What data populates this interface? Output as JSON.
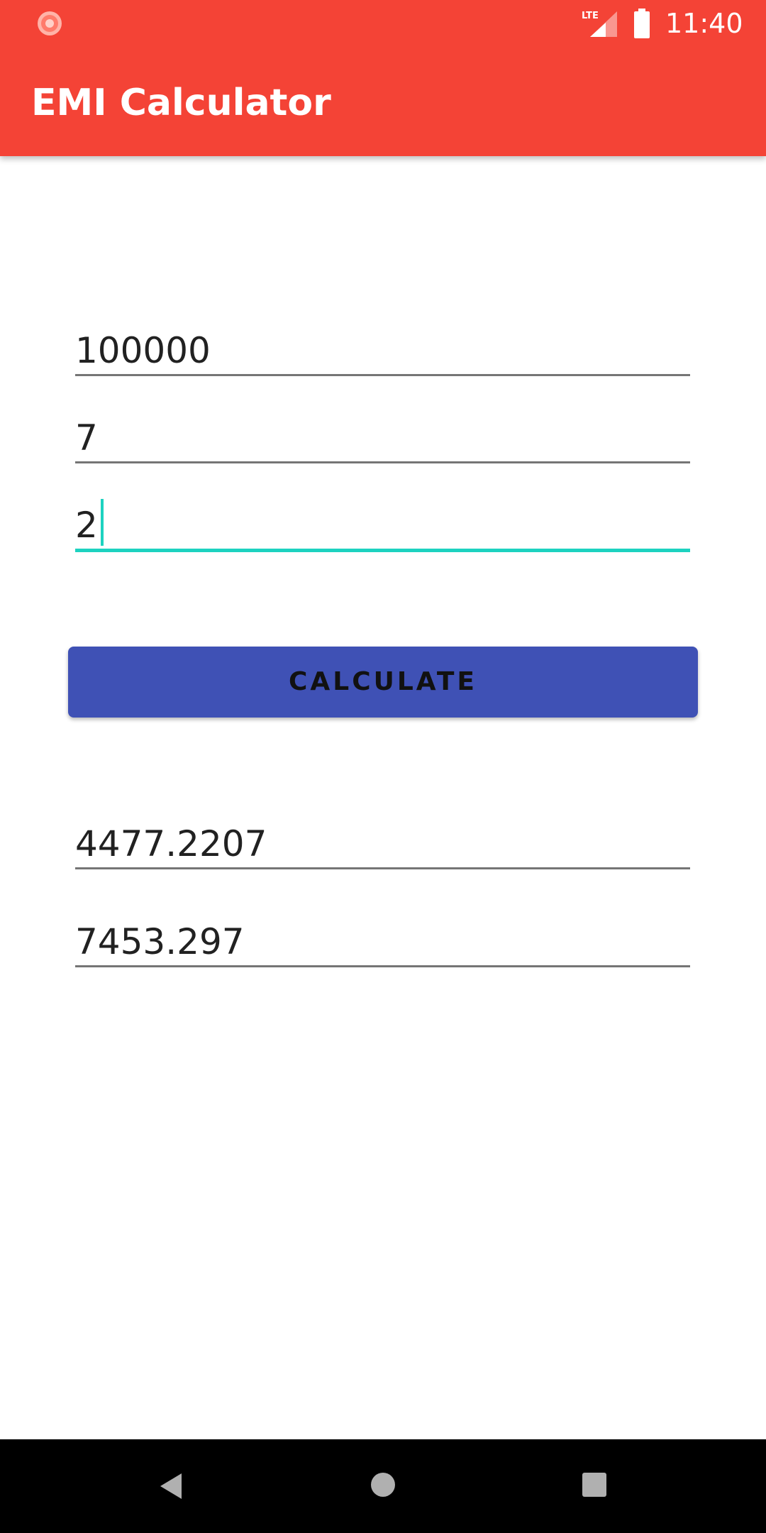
{
  "status_bar": {
    "notification_icon": "app-notification-icon",
    "network_label": "LTE",
    "signal_icon": "signal-icon",
    "battery_icon": "battery-icon",
    "time": "11:40"
  },
  "app_bar": {
    "title": "EMI Calculator"
  },
  "form": {
    "principal_value": "100000",
    "interest_rate_value": "7",
    "tenure_value": "2",
    "calculate_label": "CALCULATE"
  },
  "results": {
    "emi_value": "4477.2207",
    "total_interest_value": "7453.297"
  },
  "nav": {
    "back_icon": "back-triangle-icon",
    "home_icon": "home-circle-icon",
    "recents_icon": "recents-square-icon"
  },
  "colors": {
    "app_bar": "#f44336",
    "accent": "#1dd2c0",
    "button": "#3f51b5",
    "underline": "#757575",
    "nav_bar": "#000000"
  }
}
